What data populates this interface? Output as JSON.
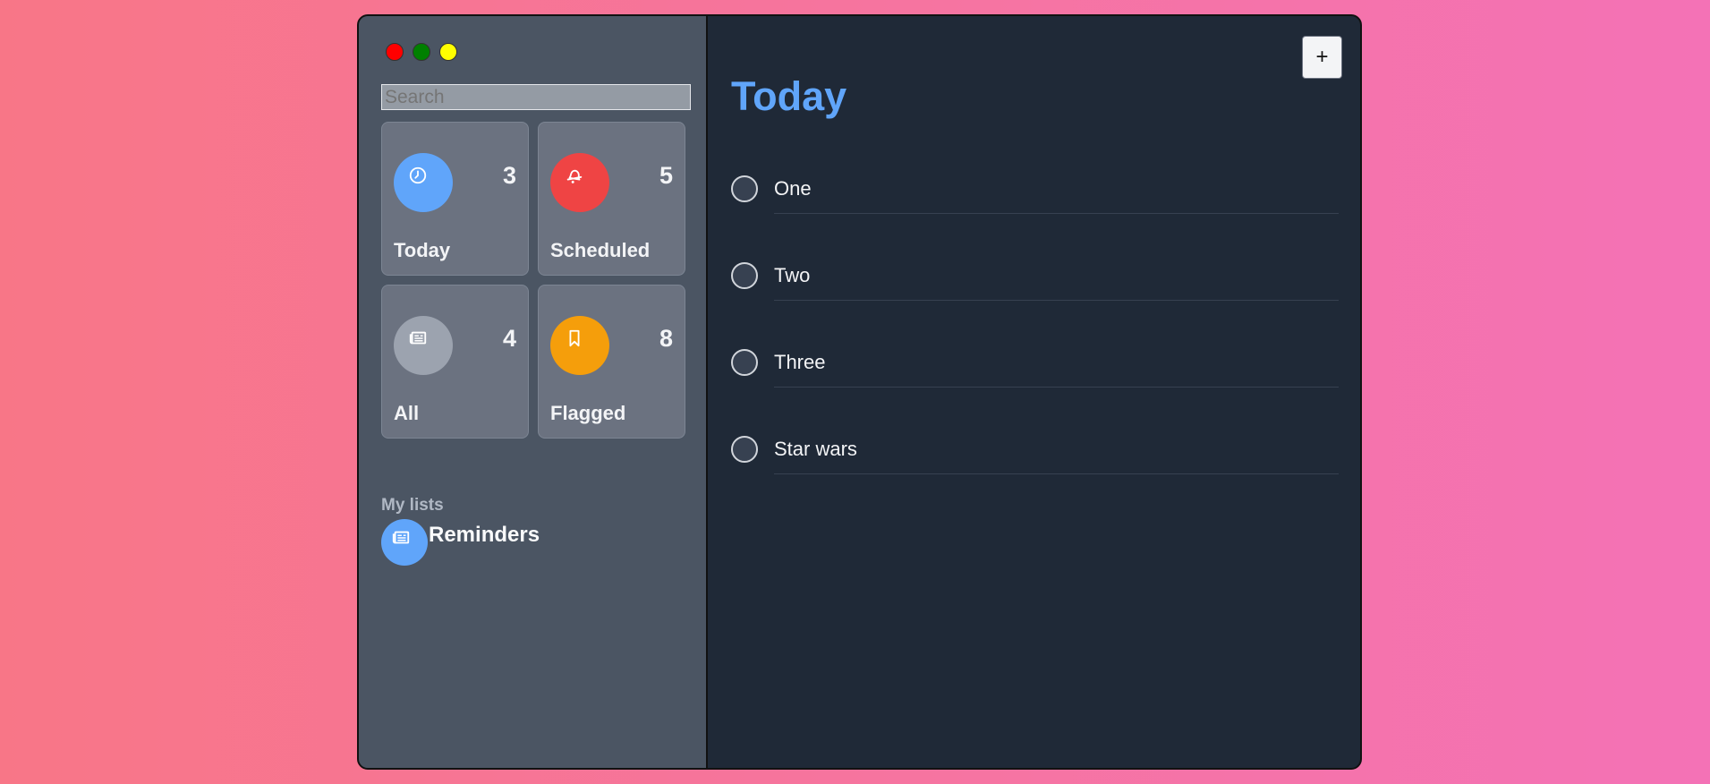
{
  "sidebar": {
    "search": {
      "placeholder": "Search",
      "value": ""
    },
    "tiles": [
      {
        "label": "Today",
        "count": "3",
        "color": "#60a5fa",
        "icon": "clock-icon"
      },
      {
        "label": "Scheduled",
        "count": "5",
        "color": "#ef4444",
        "icon": "bell-icon"
      },
      {
        "label": "All",
        "count": "4",
        "color": "#9ca3af",
        "icon": "newspaper-icon"
      },
      {
        "label": "Flagged",
        "count": "8",
        "color": "#f59e0b",
        "icon": "bookmark-icon"
      }
    ],
    "my_lists_title": "My lists",
    "lists": [
      {
        "name": "Reminders",
        "color": "#60a5fa",
        "icon": "newspaper-icon"
      }
    ]
  },
  "main": {
    "title": "Today",
    "add_label": "+",
    "tasks": [
      {
        "text": "One"
      },
      {
        "text": "Two"
      },
      {
        "text": "Three"
      },
      {
        "text": "Star wars"
      }
    ]
  }
}
